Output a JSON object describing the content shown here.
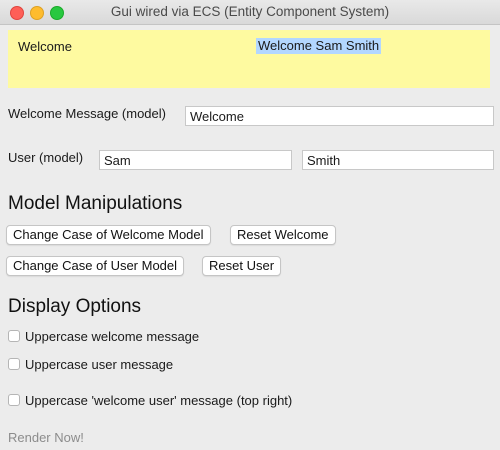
{
  "window": {
    "title": "Gui wired via ECS (Entity Component System)"
  },
  "banner": {
    "left_text": "Welcome",
    "right_text": "Welcome Sam Smith",
    "background": "#fefaa0",
    "highlight": "#b3d7ff"
  },
  "form": {
    "welcome_label": "Welcome Message (model)",
    "welcome_value": "Welcome",
    "user_label": "User (model)",
    "first_name_value": "Sam",
    "last_name_value": "Smith"
  },
  "model_manipulations": {
    "heading": "Model Manipulations",
    "change_case_welcome": "Change Case of Welcome Model",
    "reset_welcome": "Reset Welcome",
    "change_case_user": "Change Case of User Model",
    "reset_user": "Reset User"
  },
  "display_options": {
    "heading": "Display Options",
    "options": [
      {
        "label": "Uppercase welcome message",
        "checked": false
      },
      {
        "label": "Uppercase user message",
        "checked": false
      },
      {
        "label": "Uppercase 'welcome user' message (top right)",
        "checked": false
      }
    ]
  },
  "render_now": {
    "label": "Render Now!",
    "color": "#8c8c8c"
  }
}
